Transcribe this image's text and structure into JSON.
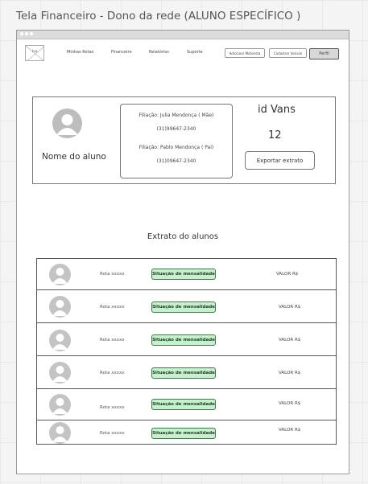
{
  "page_title": "Tela Financeiro - Dono da rede (ALUNO ESPECÍFICO )",
  "nav": {
    "logo_text": "Ico",
    "links": [
      "Minhas Rotas",
      "Financeiro",
      "Relatórios",
      "Suporte"
    ],
    "buttons": [
      "Adicionar Motorista",
      "Cadastrar Veículo",
      "Perfil"
    ]
  },
  "student_card": {
    "name": "Nome do aluno",
    "parents": [
      {
        "label": "Filiação: Julia Mendonça ( Mãe)",
        "phone": "(31)99647-2340"
      },
      {
        "label": "Filiação: Pablo Mendonça ( Pai)",
        "phone": "(31)09647-2340"
      }
    ],
    "id_vans_label": "id Vans",
    "id_vans_value": "12",
    "export_label": "Exportar extrato"
  },
  "statement": {
    "title": "Extrato do alunos",
    "rows": [
      {
        "route": "Rota xxxxx",
        "status": "Situação de mensalidade",
        "value": "VALOR R$"
      },
      {
        "route": "Rota xxxxx",
        "status": "Situação de mensalidade",
        "value": "VALOR R$"
      },
      {
        "route": "Rota xxxxx",
        "status": "Situação de mensalidade",
        "value": "VALOR R$"
      },
      {
        "route": "Rota xxxxx",
        "status": "Situação de mensalidade",
        "value": "VALOR R$"
      },
      {
        "route": "Rota xxxxx",
        "status": "Situação de mensalidade",
        "value": "VALOR R$"
      },
      {
        "route": "Rota xxxxx",
        "status": "Situação de mensalidade",
        "value": "VALOR R$"
      }
    ]
  },
  "colors": {
    "status_bg": "#c8f0cf",
    "status_border": "#3c7a47",
    "avatar": "#bdbdbd"
  }
}
